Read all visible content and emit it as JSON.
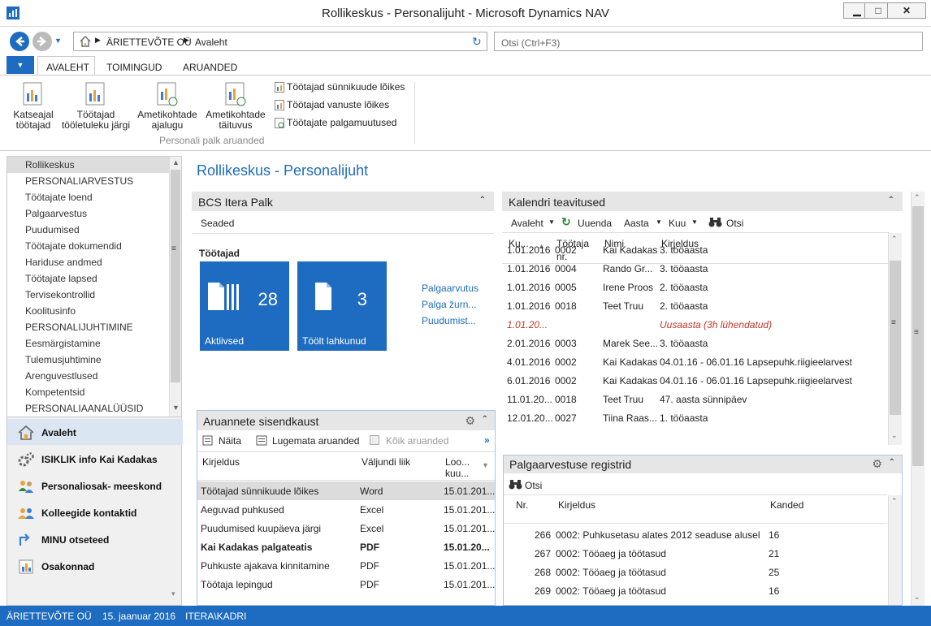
{
  "window": {
    "title": "Rollikeskus - Personalijuht - Microsoft Dynamics NAV"
  },
  "address": {
    "company": "ÄRIETTEVÕTE OÜ",
    "page": "Avaleht",
    "search_placeholder": "Otsi (Ctrl+F3)"
  },
  "ribbon": {
    "tabs": [
      "AVALEHT",
      "TOIMINGUD",
      "ARUANDED"
    ],
    "big": [
      "Katseajal töötajad",
      "Töötajad tööletuleku järgi",
      "Ametikohtade ajalugu",
      "Ametikohtade täituvus"
    ],
    "big_lines": [
      [
        "Katseajal",
        "töötajad"
      ],
      [
        "Töötajad",
        "tööletuleku järgi"
      ],
      [
        "Ametikohtade",
        "ajalugu"
      ],
      [
        "Ametikohtade",
        "täituvus"
      ]
    ],
    "small": [
      "Töötajad sünnikuude lõikes",
      "Töötajad vanuste lõikes",
      "Töötajate palgamuutused"
    ],
    "group_label": "Personali palk aruanded"
  },
  "nav": {
    "items": [
      "Rollikeskus",
      "PERSONALIARVESTUS",
      "Töötajate loend",
      "Palgaarvestus",
      "Puudumised",
      "Töötajate dokumendid",
      "Hariduse andmed",
      "Töötajate lapsed",
      "Tervisekontrollid",
      "Koolitusinfo",
      "PERSONALIJUHTIMINE",
      "Eesmärgistamine",
      "Tulemusjuhtimine",
      "Arenguvestlused",
      "Kompetentsid",
      "PERSONALIAANALÜÜSID"
    ],
    "bottom": [
      "Avaleht",
      "ISIKLIK info Kai Kadakas",
      "Personaliosak- meeskond",
      "Kolleegide kontaktid",
      "MINU otseteed",
      "Osakonnad"
    ]
  },
  "main": {
    "page_title": "Rollikeskus - Personalijuht",
    "itera": {
      "title": "BCS Itera Palk",
      "settings": "Seaded",
      "group": "Töötajad",
      "tiles": [
        {
          "value": "28",
          "label": "Aktiivsed"
        },
        {
          "value": "3",
          "label": "Töölt lahkunud"
        }
      ],
      "links": [
        "Palgaarvutus",
        "Palga žurn...",
        "Puudumist..."
      ]
    },
    "calendar": {
      "title": "Kalendri teavitused",
      "toolbar": [
        "Avaleht",
        "Uuenda",
        "Aasta",
        "Kuu",
        "Otsi"
      ],
      "columns": [
        "Ku...",
        "Töötaja nr.",
        "Nimi",
        "Kirjeldus"
      ],
      "rows": [
        [
          "1.01.2016",
          "0002",
          "Kai Kadakas",
          "3. tööaasta"
        ],
        [
          "1.01.2016",
          "0004",
          "Rando Gr...",
          "3. tööaasta"
        ],
        [
          "1.01.2016",
          "0005",
          "Irene Proos",
          "2. tööaasta"
        ],
        [
          "1.01.2016",
          "0018",
          "Teet Truu",
          "2. tööaasta"
        ],
        [
          "1.01.20...",
          "",
          "",
          "Uusaasta  (3h lühendatud)"
        ],
        [
          "2.01.2016",
          "0003",
          "Marek See...",
          "3. tööaasta"
        ],
        [
          "4.01.2016",
          "0002",
          "Kai Kadakas",
          "04.01.16 - 06.01.16 Lapsepuhk.riigieelarvest"
        ],
        [
          "6.01.2016",
          "0002",
          "Kai Kadakas",
          "04.01.16 - 06.01.16 Lapsepuhk.riigieelarvest"
        ],
        [
          "11.01.20...",
          "0018",
          "Teet Truu",
          "47. aasta sünnipäev"
        ],
        [
          "12.01.20...",
          "0027",
          "Tiina Raas...",
          "1. tööaasta"
        ]
      ]
    },
    "reports": {
      "title": "Aruannete sisendkaust",
      "toolbar": [
        "Näita",
        "Lugemata aruanded",
        "Kõik aruanded"
      ],
      "columns": [
        "Kirjeldus",
        "Väljundi liik",
        "Loo... kuu..."
      ],
      "rows": [
        [
          "Töötajad sünnikuude lõikes",
          "Word",
          "15.01.201..."
        ],
        [
          "Aeguvad puhkused",
          "Excel",
          "15.01.201..."
        ],
        [
          "Puudumised kuupäeva järgi",
          "Excel",
          "15.01.201..."
        ],
        [
          "Kai Kadakas palgateatis",
          "PDF",
          "15.01.20..."
        ],
        [
          "Puhkuste ajakava kinnitamine",
          "PDF",
          "15.01.201..."
        ],
        [
          "Töötaja lepingud",
          "PDF",
          "15.01.201..."
        ]
      ]
    },
    "registers": {
      "title": "Palgaarvestuse registrid",
      "toolbar": [
        "Otsi"
      ],
      "columns": [
        "Nr.",
        "Kirjeldus",
        "Kanded"
      ],
      "rows": [
        [
          "266",
          "0002: Puhkusetasu alates 2012 seaduse alusel",
          "16"
        ],
        [
          "267",
          "0002: Tööaeg ja töötasud",
          "21"
        ],
        [
          "268",
          "0002: Tööaeg ja töötasud",
          "25"
        ],
        [
          "269",
          "0002: Tööaeg ja töötasud",
          "16"
        ]
      ]
    }
  },
  "status": {
    "company": "ÄRIETTEVÕTE OÜ",
    "date": "15. jaanuar 2016",
    "user": "ITERA\\KADRI"
  },
  "colors": {
    "accent": "#1e6cc1",
    "link": "#1e6cbb",
    "holiday": "#c0392b"
  }
}
